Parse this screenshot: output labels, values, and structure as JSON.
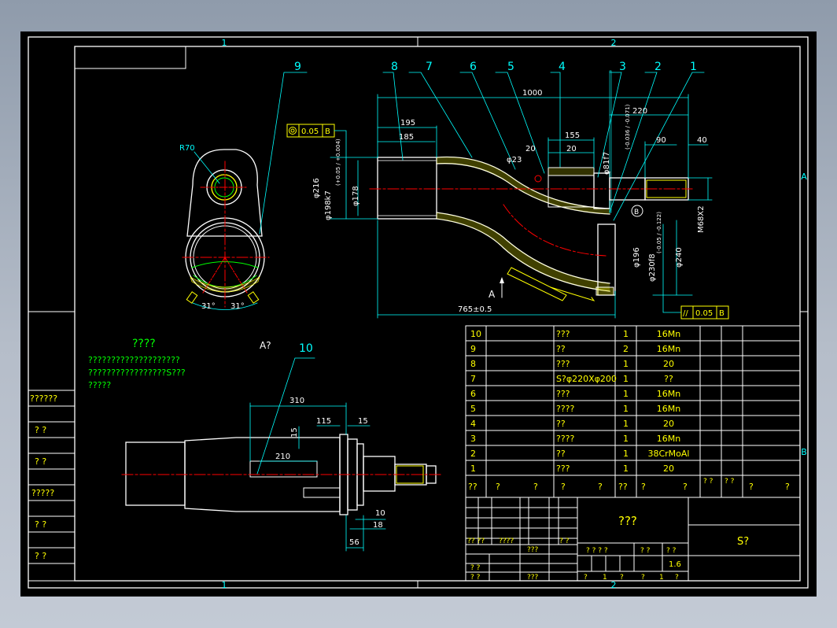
{
  "drawing": {
    "zone_labels": {
      "top_1": "1",
      "top_2": "2",
      "bottom_1": "1",
      "bottom_2": "2",
      "right_a": "A",
      "right_b": "B"
    },
    "balloons": [
      "1",
      "2",
      "3",
      "4",
      "5",
      "6",
      "7",
      "8",
      "9",
      "10"
    ],
    "tolerance_frames": {
      "concentricity_value": "0.05",
      "concentricity_datum": "B",
      "parallel_symbol": "//",
      "parallel_value": "0.05",
      "parallel_datum": "B"
    },
    "datum_label": "B",
    "view_arrow_label": "A",
    "section_label": "A?",
    "dimensions": {
      "r70": "R70",
      "d1000": "1000",
      "d220": "220",
      "d195": "195",
      "d185": "185",
      "d155": "155",
      "d20a": "20",
      "d20b": "20",
      "d90": "90",
      "d40": "40",
      "d23": "φ23",
      "d81f7": "φ81f7",
      "d81f7_tol": "(-0.036 / -0.071)",
      "d216": "φ216",
      "d198k7": "φ198k7",
      "d198k7_tol": "(+0.05 / +0.004)",
      "d178": "φ178",
      "m68": "M68X2",
      "d196": "φ196",
      "d230f8": "φ230f8",
      "d230f8_tol": "(-0.05 / -0.122)",
      "d240": "φ240",
      "d765": "765±0.5",
      "ang31a": "31°",
      "ang31b": "31°",
      "d310": "310",
      "d115": "115",
      "d15a": "15",
      "d15b": "15",
      "d210": "210",
      "d10": "10",
      "d18": "18",
      "d56": "56"
    },
    "notes": {
      "title": "????",
      "line1": "????????????????????",
      "line2": "?????????????????S???",
      "line3": "?????"
    },
    "left_strip": [
      "??????",
      "?   ?",
      "?   ?",
      "?????",
      "?   ?",
      "?   ?"
    ],
    "bom_rows": [
      {
        "no": "10",
        "code": "",
        "name": "???",
        "qty": "1",
        "material": "16Mn"
      },
      {
        "no": "9",
        "code": "",
        "name": "??",
        "qty": "2",
        "material": "16Mn"
      },
      {
        "no": "8",
        "code": "",
        "name": "???",
        "qty": "1",
        "material": "20"
      },
      {
        "no": "7",
        "code": "",
        "name": "S?φ220Xφ200",
        "qty": "1",
        "material": "??"
      },
      {
        "no": "6",
        "code": "",
        "name": "???",
        "qty": "1",
        "material": "16Mn"
      },
      {
        "no": "5",
        "code": "",
        "name": "????",
        "qty": "1",
        "material": "16Mn"
      },
      {
        "no": "4",
        "code": "",
        "name": "??",
        "qty": "1",
        "material": "20"
      },
      {
        "no": "3",
        "code": "",
        "name": "????",
        "qty": "1",
        "material": "16Mn"
      },
      {
        "no": "2",
        "code": "",
        "name": "??",
        "qty": "1",
        "material": "38CrMoAl"
      },
      {
        "no": "1",
        "code": "",
        "name": "???",
        "qty": "1",
        "material": "20"
      }
    ],
    "bom_header": [
      "??",
      "?",
      "?",
      "?",
      "?",
      "??",
      "?",
      "?",
      "? ?",
      "? ?",
      "?",
      "?"
    ],
    "title_block": {
      "part_name": "???",
      "drawing_no": "S?",
      "scale": "1.6",
      "rev_head": [
        "?? ??",
        "????",
        "???",
        "? ?"
      ],
      "stage_head": [
        "? ? ? ?",
        "? ?",
        "? ?"
      ],
      "row_a": [
        "? ?",
        "???",
        "? ?"
      ],
      "row_b": [
        "? ?",
        "? ?",
        "?",
        "1",
        "?",
        "?",
        "1",
        "?"
      ]
    }
  }
}
